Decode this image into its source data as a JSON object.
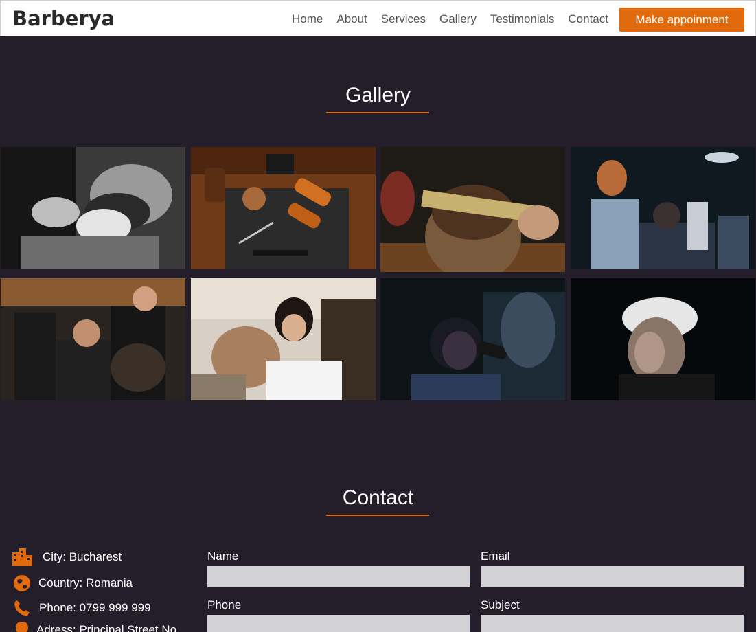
{
  "brand": "Barberya",
  "nav": {
    "links": [
      "Home",
      "About",
      "Services",
      "Gallery",
      "Testimonials",
      "Contact"
    ],
    "cta": "Make appoinment"
  },
  "gallery": {
    "title": "Gallery",
    "images": [
      "beard-trim-black-and-white",
      "barber-tools-on-wood",
      "comb-and-scissors-haircut",
      "barber-cutting-hair-shop",
      "busy-barbershop-women-barbers",
      "woman-barber-cutting-hair",
      "clipper-haircut-dark",
      "styled-platinum-hair"
    ]
  },
  "contact": {
    "title": "Contact",
    "info": [
      {
        "icon": "city-icon",
        "text": "City: Bucharest"
      },
      {
        "icon": "globe-icon",
        "text": "Country: Romania"
      },
      {
        "icon": "phone-icon",
        "text": "Phone: 0799 999 999"
      },
      {
        "icon": "location-icon",
        "text": "Adress: Principal Street No"
      }
    ],
    "form": {
      "name_label": "Name",
      "email_label": "Email",
      "phone_label": "Phone",
      "subject_label": "Subject",
      "name_value": "",
      "email_value": "",
      "phone_value": "",
      "subject_value": ""
    }
  },
  "colors": {
    "accent": "#e06a0c",
    "background": "#241e2a",
    "input": "#d2d1d5"
  }
}
